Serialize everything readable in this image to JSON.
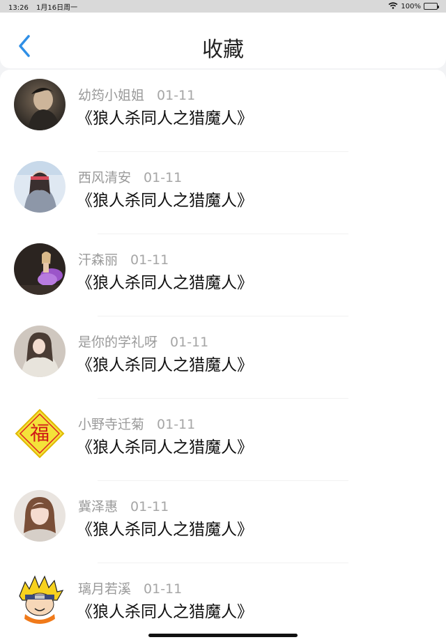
{
  "status": {
    "time": "13:26",
    "date": "1月16日周一",
    "battery": "100%"
  },
  "nav": {
    "title": "收藏"
  },
  "items": [
    {
      "name": "幼筠小姐姐",
      "date": "01-11",
      "title": "《狼人杀同人之猎魔人》"
    },
    {
      "name": "西风清安",
      "date": "01-11",
      "title": "《狼人杀同人之猎魔人》"
    },
    {
      "name": "汗森丽",
      "date": "01-11",
      "title": "《狼人杀同人之猎魔人》"
    },
    {
      "name": "是你的学礼呀",
      "date": "01-11",
      "title": "《狼人杀同人之猎魔人》"
    },
    {
      "name": "小野寺迁菊",
      "date": "01-11",
      "title": "《狼人杀同人之猎魔人》",
      "avatar_text": "福"
    },
    {
      "name": "冀泽惠",
      "date": "01-11",
      "title": "《狼人杀同人之猎魔人》"
    },
    {
      "name": "璃月若溪",
      "date": "01-11",
      "title": "《狼人杀同人之猎魔人》"
    }
  ],
  "colors": {
    "accent": "#2f8fe6"
  }
}
